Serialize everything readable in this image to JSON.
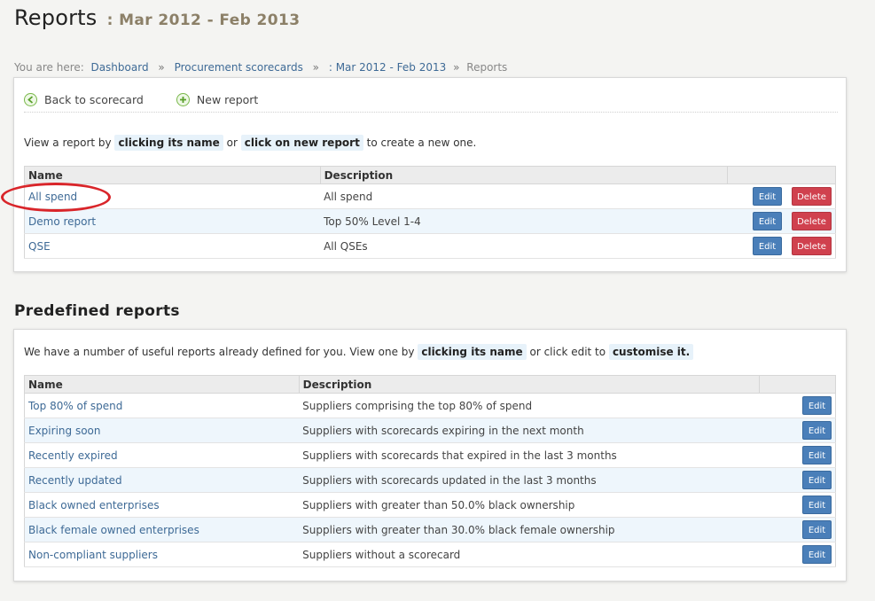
{
  "header": {
    "title": "Reports",
    "period": ": Mar 2012 - Feb 2013"
  },
  "breadcrumb": {
    "prefix": "You are here:",
    "items": [
      "Dashboard",
      "Procurement scorecards",
      ": Mar 2012 - Feb 2013"
    ],
    "current": "Reports",
    "separator": "»"
  },
  "actions": {
    "back": "Back to scorecard",
    "new_report": "New report"
  },
  "my_reports": {
    "intro_1": "View a report by",
    "intro_hl1": "clicking its name",
    "intro_2": "or",
    "intro_hl2": "click on new report",
    "intro_3": "to create a new one.",
    "columns": [
      "Name",
      "Description"
    ],
    "rows": [
      {
        "name": "All spend",
        "description": "All spend"
      },
      {
        "name": "Demo report",
        "description": "Top 50% Level 1-4"
      },
      {
        "name": "QSE",
        "description": "All QSEs"
      }
    ],
    "edit_label": "Edit",
    "delete_label": "Delete"
  },
  "predefined": {
    "heading": "Predefined reports",
    "intro_1": "We have a number of useful reports already defined for you. View one by",
    "intro_hl1": "clicking its name",
    "intro_2": "or click edit to",
    "intro_hl2": "customise it.",
    "columns": [
      "Name",
      "Description"
    ],
    "rows": [
      {
        "name": "Top 80% of spend",
        "description": "Suppliers comprising the top 80% of spend"
      },
      {
        "name": "Expiring soon",
        "description": "Suppliers with scorecards expiring in the next month"
      },
      {
        "name": "Recently expired",
        "description": "Suppliers with scorecards that expired in the last 3 months"
      },
      {
        "name": "Recently updated",
        "description": "Suppliers with scorecards updated in the last 3 months"
      },
      {
        "name": "Black owned enterprises",
        "description": "Suppliers with greater than 50.0% black ownership"
      },
      {
        "name": "Black female owned enterprises",
        "description": "Suppliers with greater than 30.0% black female ownership"
      },
      {
        "name": "Non-compliant suppliers",
        "description": "Suppliers without a scorecard"
      }
    ],
    "edit_label": "Edit"
  },
  "colors": {
    "link": "#3e6a96",
    "edit_button": "#4a7fb9",
    "delete_button": "#d0414e",
    "highlight": "#e7f2fa",
    "annotation": "#d9252a"
  }
}
